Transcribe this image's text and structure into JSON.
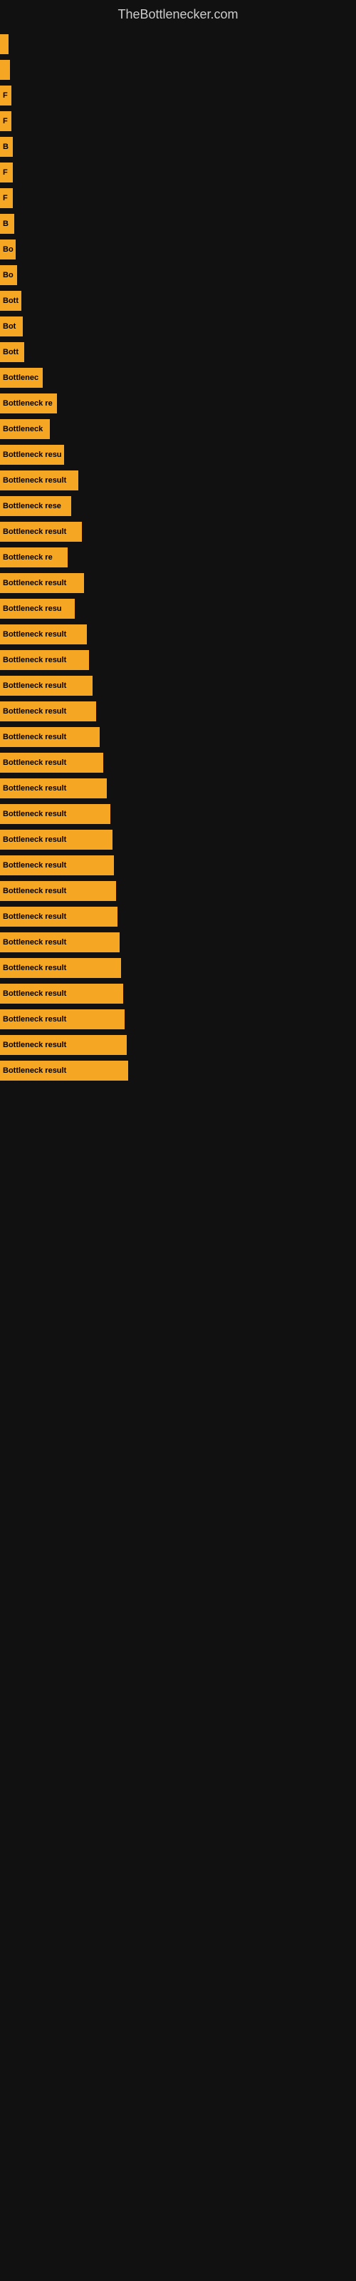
{
  "site": {
    "title": "TheBottlenecker.com"
  },
  "bars": [
    {
      "width": 12,
      "label": ""
    },
    {
      "width": 14,
      "label": ""
    },
    {
      "width": 16,
      "label": "F"
    },
    {
      "width": 16,
      "label": "F"
    },
    {
      "width": 18,
      "label": "B"
    },
    {
      "width": 18,
      "label": "F"
    },
    {
      "width": 18,
      "label": "F"
    },
    {
      "width": 20,
      "label": "B"
    },
    {
      "width": 22,
      "label": "Bo"
    },
    {
      "width": 24,
      "label": "Bo"
    },
    {
      "width": 30,
      "label": "Bott"
    },
    {
      "width": 32,
      "label": "Bot"
    },
    {
      "width": 34,
      "label": "Bott"
    },
    {
      "width": 60,
      "label": "Bottlenec"
    },
    {
      "width": 80,
      "label": "Bottleneck re"
    },
    {
      "width": 70,
      "label": "Bottleneck"
    },
    {
      "width": 90,
      "label": "Bottleneck resu"
    },
    {
      "width": 110,
      "label": "Bottleneck result"
    },
    {
      "width": 100,
      "label": "Bottleneck rese"
    },
    {
      "width": 115,
      "label": "Bottleneck result"
    },
    {
      "width": 95,
      "label": "Bottleneck re"
    },
    {
      "width": 118,
      "label": "Bottleneck result"
    },
    {
      "width": 105,
      "label": "Bottleneck resu"
    },
    {
      "width": 122,
      "label": "Bottleneck result"
    },
    {
      "width": 125,
      "label": "Bottleneck result"
    },
    {
      "width": 130,
      "label": "Bottleneck result"
    },
    {
      "width": 135,
      "label": "Bottleneck result"
    },
    {
      "width": 140,
      "label": "Bottleneck result"
    },
    {
      "width": 145,
      "label": "Bottleneck result"
    },
    {
      "width": 150,
      "label": "Bottleneck result"
    },
    {
      "width": 155,
      "label": "Bottleneck result"
    },
    {
      "width": 158,
      "label": "Bottleneck result"
    },
    {
      "width": 160,
      "label": "Bottleneck result"
    },
    {
      "width": 163,
      "label": "Bottleneck result"
    },
    {
      "width": 165,
      "label": "Bottleneck result"
    },
    {
      "width": 168,
      "label": "Bottleneck result"
    },
    {
      "width": 170,
      "label": "Bottleneck result"
    },
    {
      "width": 173,
      "label": "Bottleneck result"
    },
    {
      "width": 175,
      "label": "Bottleneck result"
    },
    {
      "width": 178,
      "label": "Bottleneck result"
    },
    {
      "width": 180,
      "label": "Bottleneck result"
    }
  ]
}
